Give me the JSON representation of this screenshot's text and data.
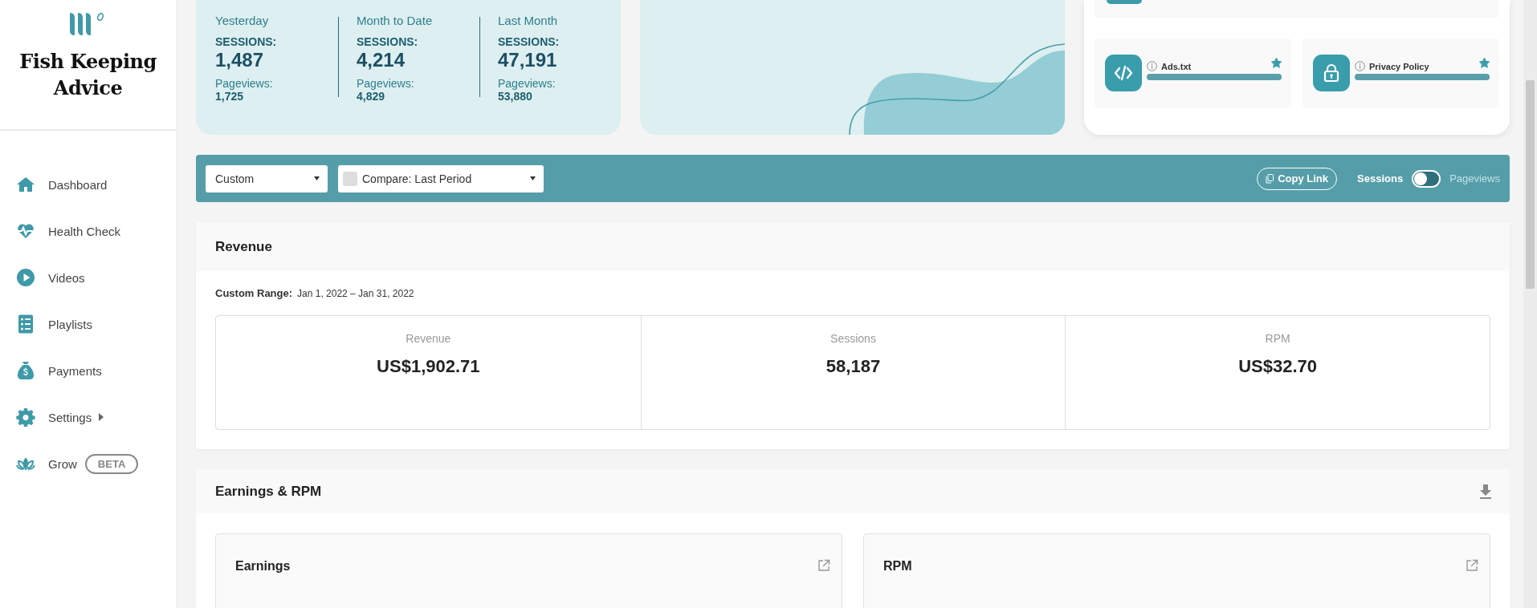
{
  "sidebar": {
    "site_title": "Fish Keeping Advice",
    "items": [
      {
        "label": "Dashboard",
        "selected": false
      },
      {
        "label": "Health Check",
        "selected": false
      },
      {
        "label": "Videos",
        "selected": false
      },
      {
        "label": "Playlists",
        "selected": false
      },
      {
        "label": "Payments",
        "selected": false
      },
      {
        "label": "Settings",
        "selected": false,
        "has_submenu": true
      },
      {
        "label": "Grow",
        "selected": false,
        "badge": "BETA"
      }
    ]
  },
  "summary": {
    "periods": [
      {
        "label": "Yesterday",
        "sessions_label": "SESSIONS:",
        "sessions": "1,487",
        "pageviews_label": "Pageviews:",
        "pageviews": "1,725"
      },
      {
        "label": "Month to Date",
        "sessions_label": "SESSIONS:",
        "sessions": "4,214",
        "pageviews_label": "Pageviews:",
        "pageviews": "4,829"
      },
      {
        "label": "Last Month",
        "sessions_label": "SESSIONS:",
        "sessions": "47,191",
        "pageviews_label": "Pageviews:",
        "pageviews": "53,880"
      }
    ]
  },
  "health": {
    "tiles": [
      {
        "label": "Ads.txt",
        "level": 1,
        "starred": true
      },
      {
        "label": "Privacy Policy",
        "level": 1,
        "starred": true
      }
    ]
  },
  "filters": {
    "range": {
      "value": "Custom"
    },
    "compare": {
      "value": "Compare: Last Period",
      "checked": false
    },
    "copy_link": "Copy Link",
    "metric_toggle": [
      {
        "label": "Sessions",
        "selected": true
      },
      {
        "label": "Pageviews",
        "selected": false
      }
    ]
  },
  "revenue": {
    "title": "Revenue",
    "range_label": "Custom Range:",
    "range_value": "Jan 1, 2022 – Jan 31, 2022",
    "metrics": [
      {
        "label": "Revenue",
        "value": "US$1,902.71"
      },
      {
        "label": "Sessions",
        "value": "58,187"
      },
      {
        "label": "RPM",
        "value": "US$32.70"
      }
    ]
  },
  "earnings": {
    "title": "Earnings & RPM",
    "panels": [
      {
        "title": "Earnings"
      },
      {
        "title": "RPM"
      }
    ]
  }
}
